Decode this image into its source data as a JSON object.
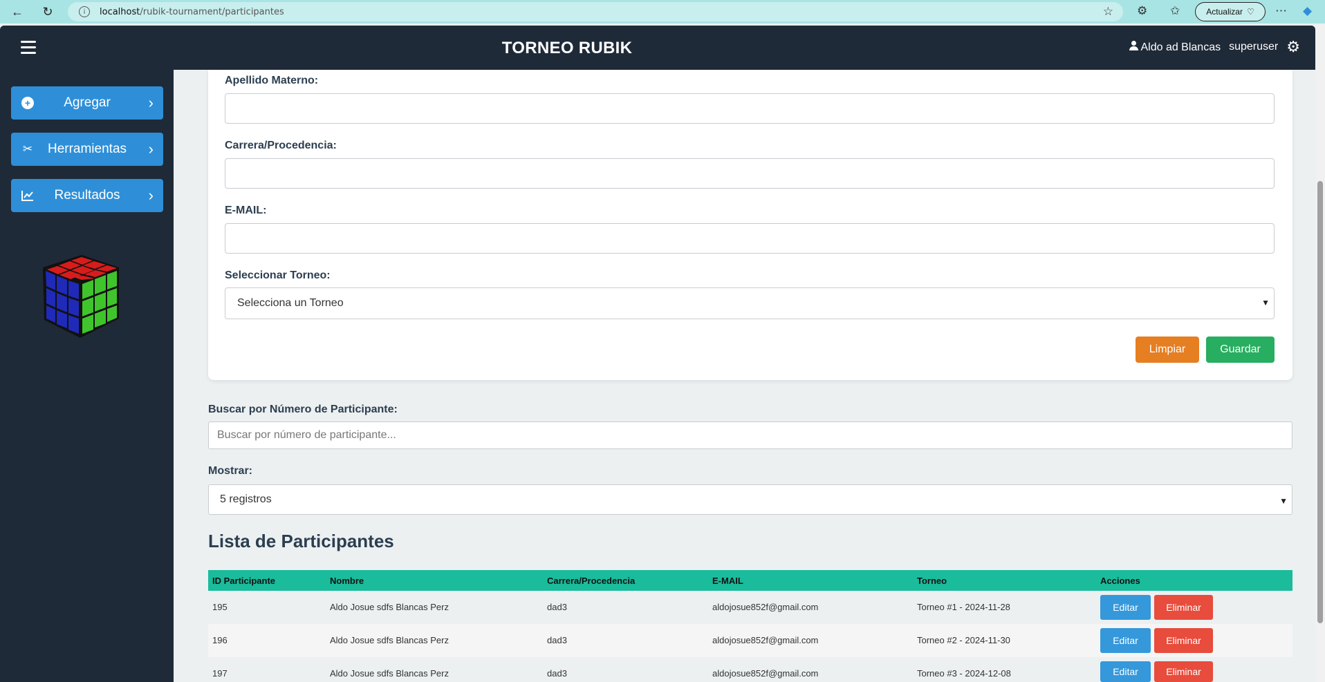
{
  "browser": {
    "url_host": "localhost",
    "url_path": "/rubik-tournament/participantes",
    "update_label": "Actualizar"
  },
  "header": {
    "title": "TORNEO RUBIK",
    "user_name": "Aldo ad Blancas",
    "role": "superuser"
  },
  "sidebar": {
    "items": [
      {
        "label": "Agregar",
        "icon": "plus-circle-icon"
      },
      {
        "label": "Herramientas",
        "icon": "tools-icon"
      },
      {
        "label": "Resultados",
        "icon": "chart-line-icon"
      }
    ]
  },
  "form": {
    "apellido_materno_label": "Apellido Materno:",
    "carrera_label": "Carrera/Procedencia:",
    "email_label": "E-MAIL:",
    "torneo_label": "Seleccionar Torneo:",
    "torneo_selected": "Selecciona un Torneo",
    "clear_label": "Limpiar",
    "save_label": "Guardar"
  },
  "search": {
    "label": "Buscar por Número de Participante:",
    "placeholder": "Buscar por número de participante..."
  },
  "show": {
    "label": "Mostrar:",
    "selected": "5 registros"
  },
  "list": {
    "title": "Lista de Participantes",
    "columns": [
      "ID Participante",
      "Nombre",
      "Carrera/Procedencia",
      "E-MAIL",
      "Torneo",
      "Acciones"
    ],
    "rows": [
      {
        "id": "195",
        "nombre": "Aldo Josue sdfs Blancas Perz",
        "carrera": "dad3",
        "email": "aldojosue852f@gmail.com",
        "torneo": "Torneo #1 - 2024-11-28"
      },
      {
        "id": "196",
        "nombre": "Aldo Josue sdfs Blancas Perz",
        "carrera": "dad3",
        "email": "aldojosue852f@gmail.com",
        "torneo": "Torneo #2 - 2024-11-30"
      },
      {
        "id": "197",
        "nombre": "Aldo Josue sdfs Blancas Perz",
        "carrera": "dad3",
        "email": "aldojosue852f@gmail.com",
        "torneo": "Torneo #3 - 2024-12-08"
      }
    ],
    "edit_label": "Editar",
    "delete_label": "Eliminar"
  },
  "colors": {
    "header_bg": "#1f2a38",
    "sidebar_button": "#2e8fd8",
    "table_header": "#1abc9c",
    "clear_button": "#e67e22",
    "save_button": "#27ae60",
    "edit_button": "#3498db",
    "delete_button": "#e74c3c"
  }
}
